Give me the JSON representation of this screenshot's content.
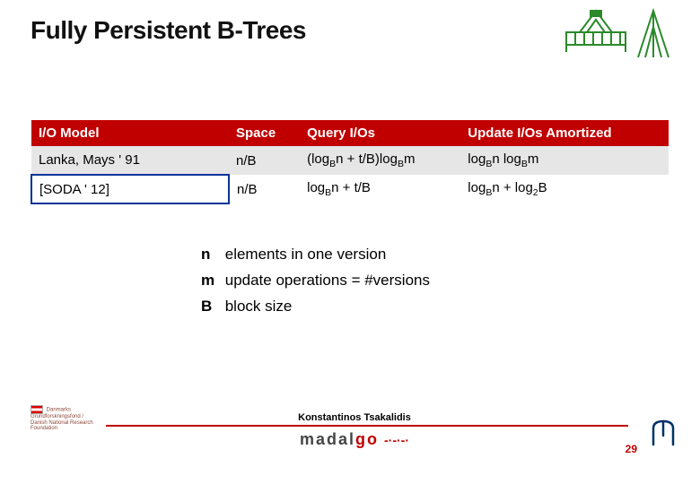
{
  "title": "Fully Persistent B-Trees",
  "table": {
    "headers": [
      "I/O Model",
      "Space",
      "Query I/Os",
      "Update I/Os Amortized"
    ],
    "rows": [
      {
        "ref": "Lanka, Mays ' 91",
        "space": "n/B",
        "query_html": "(log<span class=sub>B</span>n + t/B)log<span class=sub>B</span>m",
        "update_html": "log<span class=sub>B</span>n log<span class=sub>B</span>m"
      },
      {
        "ref": "[SODA ' 12]",
        "space": "n/B",
        "query_html": "log<span class=sub>B</span>n + t/B",
        "update_html": "log<span class=sub>B</span>n + log<span class=sub>2</span>B"
      }
    ]
  },
  "legend": [
    {
      "sym": "n",
      "text": "elements in one version"
    },
    {
      "sym": "m",
      "text": "update operations = #versions"
    },
    {
      "sym": "B",
      "text": " block size"
    }
  ],
  "footer": {
    "name": "Konstantinos Tsakalidis",
    "left_text": "Danmarks Grundforskningsfond / Danish National Research Foundation",
    "logo_text_1": "madal",
    "logo_text_2": "go",
    "page_no": "29"
  }
}
